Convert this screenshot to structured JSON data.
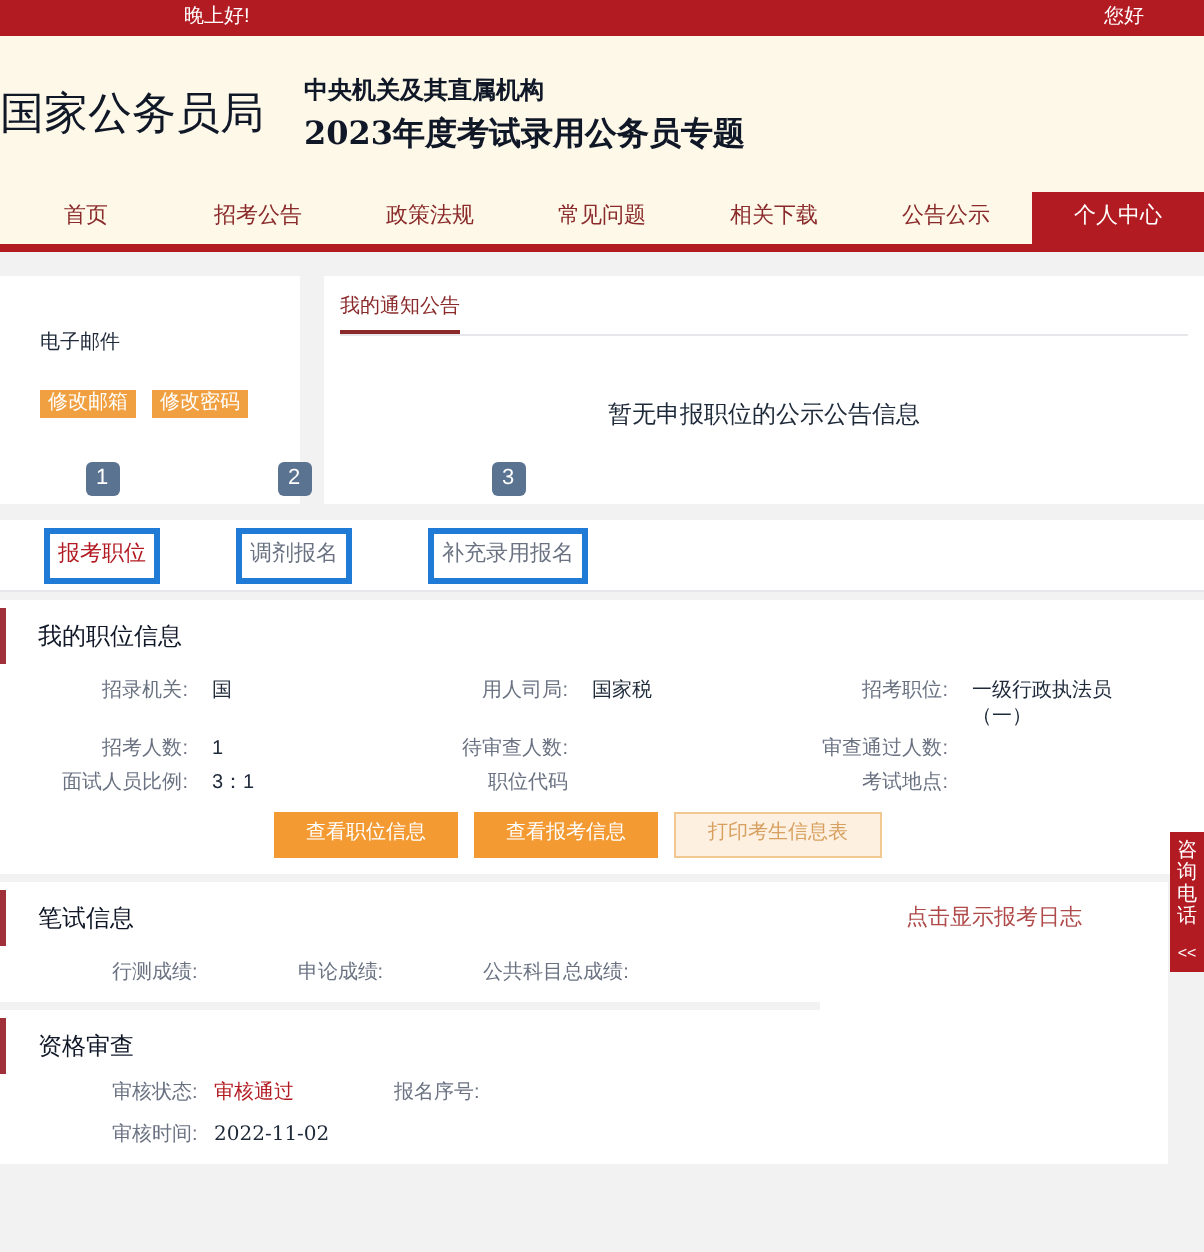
{
  "top_bar": {
    "greeting": "晚上好!",
    "hello": "您好"
  },
  "header": {
    "logo": "国家公务员局",
    "subtitle": "中央机关及其直属机构",
    "title": "2023年度考试录用公务员专题"
  },
  "nav": [
    {
      "label": "首页",
      "selected": false
    },
    {
      "label": "招考公告",
      "selected": false
    },
    {
      "label": "政策法规",
      "selected": false
    },
    {
      "label": "常见问题",
      "selected": false
    },
    {
      "label": "相关下载",
      "selected": false
    },
    {
      "label": "公告公示",
      "selected": false
    },
    {
      "label": "个人中心",
      "selected": true
    }
  ],
  "account": {
    "email_label": "电子邮件",
    "buttons": [
      "修改邮箱",
      "修改密码"
    ]
  },
  "notices": {
    "tab": "我的通知公告",
    "message": "暂无申报职位的公示公告信息"
  },
  "tabs": [
    {
      "label": "报考职位",
      "selected": true,
      "badge": "1"
    },
    {
      "label": "调剂报名",
      "selected": false,
      "badge": "2"
    },
    {
      "label": "补充录用报名",
      "selected": false,
      "badge": "3"
    }
  ],
  "position": {
    "title": "我的职位信息",
    "fields": [
      {
        "label": "招录机关:",
        "value": "国"
      },
      {
        "label": "用人司局:",
        "value": "国家税"
      },
      {
        "label": "招考职位:",
        "value": "一级行政执法员（一）"
      },
      {
        "label": "招考人数:",
        "value": "1"
      },
      {
        "label": "待审查人数:"
      },
      {
        "label": "审查通过人数:"
      },
      {
        "label": "面试人员比例:",
        "value": "3：1"
      },
      {
        "label": "职位代码"
      },
      {
        "label": "考试地点:"
      }
    ],
    "buttons": [
      {
        "label": "查看职位信息",
        "disabled": false
      },
      {
        "label": "查看报考信息",
        "disabled": false
      },
      {
        "label": "打印考生信息表",
        "disabled": true
      }
    ]
  },
  "written": {
    "title": "笔试信息",
    "fields": [
      "行测成绩:",
      "申论成绩:",
      "公共科目总成绩:"
    ],
    "log_link": "点击显示报考日志"
  },
  "review": {
    "title": "资格审查",
    "status_label": "审核状态:",
    "status": "审核通过",
    "serial_label": "报名序号:",
    "time_label": "审核时间:",
    "time": "2022-11-02"
  },
  "side_tab": {
    "label": "咨询电话",
    "arrow": "<<"
  }
}
